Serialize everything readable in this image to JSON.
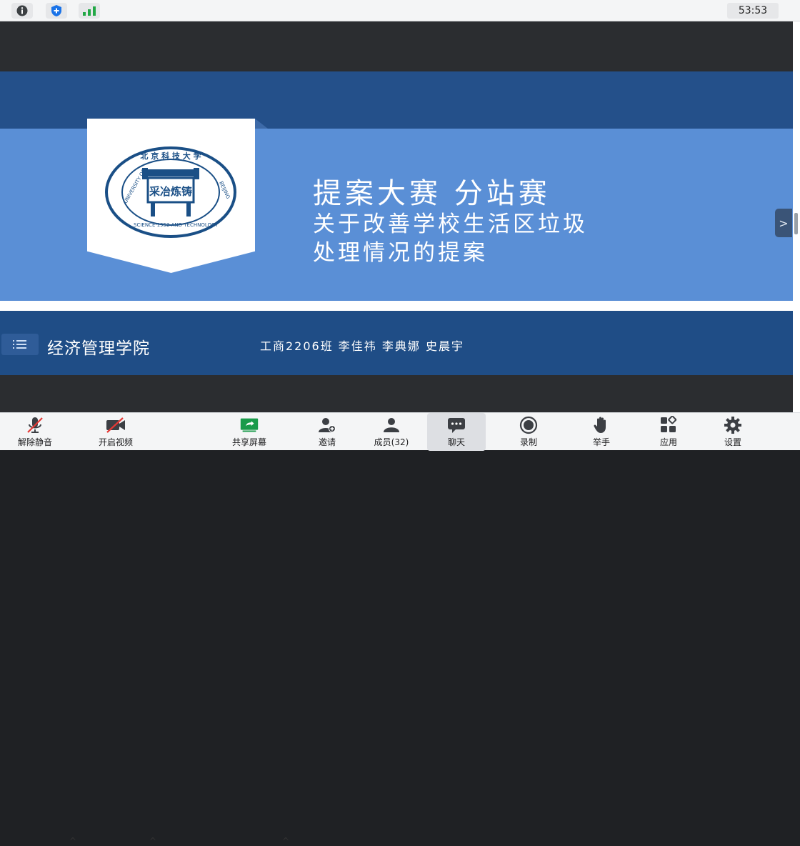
{
  "statusbar": {
    "timer": "53:53",
    "icons": [
      "info-icon",
      "shield-icon",
      "signal-icon"
    ]
  },
  "slide": {
    "title": "提案大赛 分站赛",
    "subtitle_line1": "关于改善学校生活区垃圾",
    "subtitle_line2": "处理情况的提案",
    "college": "经济管理学院",
    "authors": "工商2206班 李佳祎 李典娜 史晨宇",
    "seal": {
      "top_text": "北京科技大学",
      "ring_text": "UNIVERSITY OF SCIENCE · 1952 · AND TECHNOLOGY BEIJING",
      "center_text": "采冶炼铸"
    },
    "colors": {
      "dark_blue": "#24508a",
      "light_blue": "#5a8fd6",
      "seal_blue": "#1a4f86"
    }
  },
  "side_toggle": ">",
  "toolbar": {
    "unmute": "解除静音",
    "start_video": "开启视频",
    "share_screen": "共享屏幕",
    "invite": "邀请",
    "members": "成员(32)",
    "chat": "聊天",
    "record": "录制",
    "raise_hand": "举手",
    "apps": "应用",
    "settings": "设置",
    "caret": "^"
  }
}
